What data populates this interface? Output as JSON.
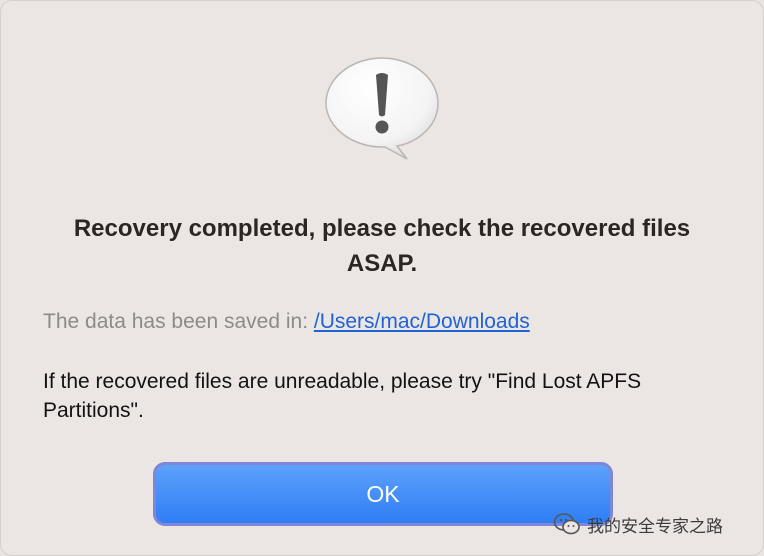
{
  "dialog": {
    "icon": "alert-speech-bubble-icon",
    "title": "Recovery completed, please check the recovered files ASAP.",
    "saved_prefix": "The data has been saved in: ",
    "saved_path": "/Users/mac/Downloads",
    "hint": "If the recovered files are unreadable, please try \"Find Lost APFS Partitions\".",
    "ok_label": "OK"
  },
  "watermark": {
    "icon": "wechat-icon",
    "text": "我的安全专家之路"
  },
  "colors": {
    "background": "#ebe6e3",
    "link": "#1f63d6",
    "button": "#3a86f7",
    "button_focus_ring": "#7f86d6"
  }
}
